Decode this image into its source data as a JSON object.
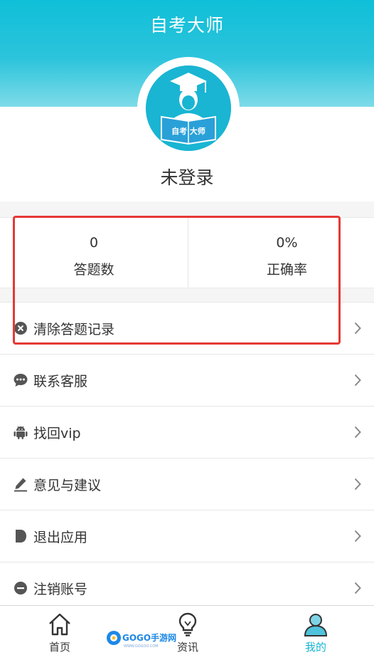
{
  "header": {
    "title": "自考大师"
  },
  "avatar": {
    "badge_text": "自考 大师"
  },
  "profile": {
    "status": "未登录"
  },
  "stats": [
    {
      "value": "0",
      "label": "答题数"
    },
    {
      "value": "0%",
      "label": "正确率"
    }
  ],
  "menu": [
    {
      "label": "清除答题记录",
      "icon": "clear-circle-icon"
    },
    {
      "label": "联系客服",
      "icon": "chat-bubble-icon"
    },
    {
      "label": "找回vip",
      "icon": "android-icon"
    },
    {
      "label": "意见与建议",
      "icon": "pencil-icon"
    },
    {
      "label": "退出应用",
      "icon": "exit-icon"
    },
    {
      "label": "注销账号",
      "icon": "minus-circle-icon"
    }
  ],
  "tabs": [
    {
      "label": "首页",
      "icon": "home-icon"
    },
    {
      "label": "资讯",
      "icon": "lightbulb-icon"
    },
    {
      "label": "我的",
      "icon": "user-icon",
      "active": true
    }
  ],
  "watermark": {
    "text": "GOGO手游网",
    "subtext": "WWW.GOGOO.COM"
  },
  "colors": {
    "header_top": "#0fbfd8",
    "accent": "#19b5d3",
    "highlight": "#e53935",
    "text": "#333333",
    "background": "#f5f5f5"
  }
}
